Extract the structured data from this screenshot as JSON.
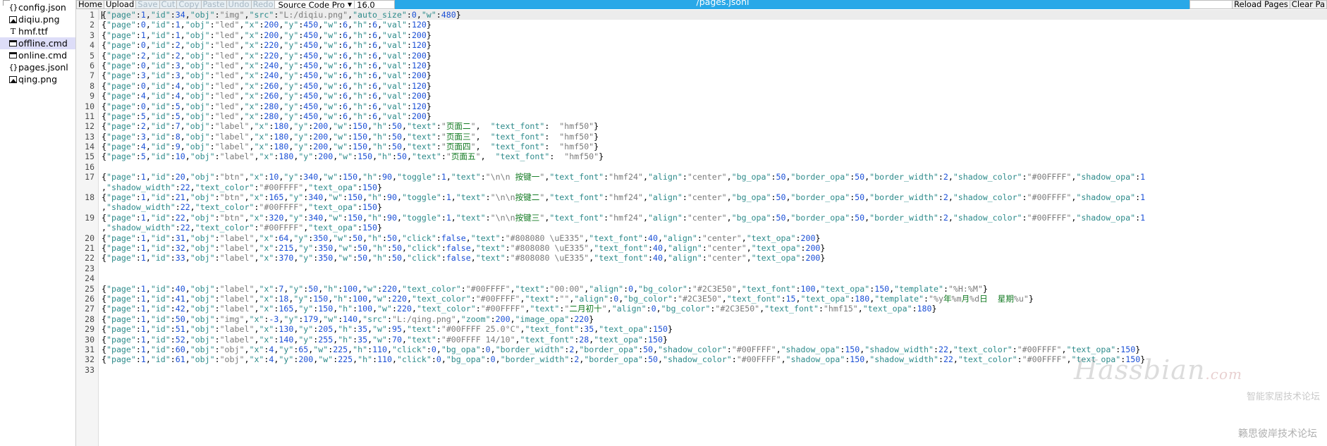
{
  "window": {
    "title": "/pages.jsonl",
    "accent_color": "#29a8e8"
  },
  "sidebar": {
    "files": [
      {
        "name": "config.json",
        "icon": "json-file-icon",
        "glyph": "{}",
        "selected": false
      },
      {
        "name": "diqiu.png",
        "icon": "image-file-icon",
        "glyph": "",
        "selected": false
      },
      {
        "name": "hmf.ttf",
        "icon": "font-file-icon",
        "glyph": "T",
        "selected": false
      },
      {
        "name": "offline.cmd",
        "icon": "cmd-file-icon",
        "glyph": "",
        "selected": true
      },
      {
        "name": "online.cmd",
        "icon": "cmd-file-icon",
        "glyph": "",
        "selected": false
      },
      {
        "name": "pages.jsonl",
        "icon": "json-file-icon",
        "glyph": "{}",
        "selected": false
      },
      {
        "name": "qing.png",
        "icon": "image-file-icon",
        "glyph": "",
        "selected": false
      }
    ]
  },
  "toolbar": {
    "buttons": [
      {
        "label": "Home",
        "state": "normal"
      },
      {
        "label": "Upload",
        "state": "active"
      },
      {
        "label": "Save",
        "state": "disabled"
      },
      {
        "label": "Cut",
        "state": "disabled"
      },
      {
        "label": "Copy",
        "state": "disabled"
      },
      {
        "label": "Paste",
        "state": "disabled"
      },
      {
        "label": "Undo",
        "state": "disabled"
      },
      {
        "label": "Redo",
        "state": "disabled"
      }
    ],
    "font_select": {
      "value": "Source Code Pro",
      "chevron": "chevron-down-icon"
    },
    "font_size": "16.0"
  },
  "toolbar_right": {
    "input_value": "",
    "input_placeholder": "",
    "reload_label": "Reload Pages",
    "clear_label": "Clear Pa"
  },
  "editor": {
    "line_numbers": [
      "1",
      "2",
      "3",
      "4",
      "5",
      "6",
      "7",
      "8",
      "9",
      "10",
      "11",
      "12",
      "13",
      "14",
      "15",
      "16",
      "17",
      "",
      "18",
      "",
      "19",
      "",
      "20",
      "21",
      "22",
      "23",
      "24",
      "25",
      "26",
      "27",
      "28",
      "29",
      "30",
      "31",
      "32",
      "33"
    ],
    "lines": [
      {
        "n": 1,
        "highlight": true,
        "caret": true,
        "text": "{\"page\":1,\"id\":34,\"obj\":\"img\",\"src\":\"L:/diqiu.png\",\"auto_size\":0,\"w\":480}"
      },
      {
        "n": 2,
        "text": "{\"page\":0,\"id\":1,\"obj\":\"led\",\"x\":200,\"y\":450,\"w\":6,\"h\":6,\"val\":120}"
      },
      {
        "n": 3,
        "text": "{\"page\":1,\"id\":1,\"obj\":\"led\",\"x\":200,\"y\":450,\"w\":6,\"h\":6,\"val\":200}"
      },
      {
        "n": 4,
        "text": "{\"page\":0,\"id\":2,\"obj\":\"led\",\"x\":220,\"y\":450,\"w\":6,\"h\":6,\"val\":120}"
      },
      {
        "n": 5,
        "text": "{\"page\":2,\"id\":2,\"obj\":\"led\",\"x\":220,\"y\":450,\"w\":6,\"h\":6,\"val\":200}"
      },
      {
        "n": 6,
        "text": "{\"page\":0,\"id\":3,\"obj\":\"led\",\"x\":240,\"y\":450,\"w\":6,\"h\":6,\"val\":120}"
      },
      {
        "n": 7,
        "text": "{\"page\":3,\"id\":3,\"obj\":\"led\",\"x\":240,\"y\":450,\"w\":6,\"h\":6,\"val\":200}"
      },
      {
        "n": 8,
        "text": "{\"page\":0,\"id\":4,\"obj\":\"led\",\"x\":260,\"y\":450,\"w\":6,\"h\":6,\"val\":120}"
      },
      {
        "n": 9,
        "text": "{\"page\":4,\"id\":4,\"obj\":\"led\",\"x\":260,\"y\":450,\"w\":6,\"h\":6,\"val\":200}"
      },
      {
        "n": 10,
        "text": "{\"page\":0,\"id\":5,\"obj\":\"led\",\"x\":280,\"y\":450,\"w\":6,\"h\":6,\"val\":120}"
      },
      {
        "n": 11,
        "text": "{\"page\":5,\"id\":5,\"obj\":\"led\",\"x\":280,\"y\":450,\"w\":6,\"h\":6,\"val\":200}"
      },
      {
        "n": 12,
        "text": "{\"page\":2,\"id\":7,\"obj\":\"label\",\"x\":180,\"y\":200,\"w\":150,\"h\":50,\"text\":\"页面二\",  \"text_font\":  \"hmf50\"}"
      },
      {
        "n": 13,
        "text": "{\"page\":3,\"id\":8,\"obj\":\"label\",\"x\":180,\"y\":200,\"w\":150,\"h\":50,\"text\":\"页面三\",  \"text_font\":  \"hmf50\"}"
      },
      {
        "n": 14,
        "text": "{\"page\":4,\"id\":9,\"obj\":\"label\",\"x\":180,\"y\":200,\"w\":150,\"h\":50,\"text\":\"页面四\",  \"text_font\":  \"hmf50\"}"
      },
      {
        "n": 15,
        "text": "{\"page\":5,\"id\":10,\"obj\":\"label\",\"x\":180,\"y\":200,\"w\":150,\"h\":50,\"text\":\"页面五\",  \"text_font\":  \"hmf50\"}"
      },
      {
        "n": 16,
        "text": ""
      },
      {
        "n": 17,
        "text": "{\"page\":1,\"id\":20,\"obj\":\"btn\",\"x\":10,\"y\":340,\"w\":150,\"h\":90,\"toggle\":1,\"text\":\"\\n\\n 按键一\",\"text_font\":\"hmf24\",\"align\":\"center\",\"bg_opa\":50,\"border_opa\":50,\"border_width\":2,\"shadow_color\":\"#00FFFF\",\"shadow_opa\":1"
      },
      {
        "n": 17,
        "wrap": true,
        "text": ",\"shadow_width\":22,\"text_color\":\"#00FFFF\",\"text_opa\":150}"
      },
      {
        "n": 18,
        "text": "{\"page\":1,\"id\":21,\"obj\":\"btn\",\"x\":165,\"y\":340,\"w\":150,\"h\":90,\"toggle\":1,\"text\":\"\\n\\n按键二\",\"text_font\":\"hmf24\",\"align\":\"center\",\"bg_opa\":50,\"border_opa\":50,\"border_width\":2,\"shadow_color\":\"#00FFFF\",\"shadow_opa\":1"
      },
      {
        "n": 18,
        "wrap": true,
        "text": ",\"shadow_width\":22,\"text_color\":\"#00FFFF\",\"text_opa\":150}"
      },
      {
        "n": 19,
        "text": "{\"page\":1,\"id\":22,\"obj\":\"btn\",\"x\":320,\"y\":340,\"w\":150,\"h\":90,\"toggle\":1,\"text\":\"\\n\\n按键三\",\"text_font\":\"hmf24\",\"align\":\"center\",\"bg_opa\":50,\"border_opa\":50,\"border_width\":2,\"shadow_color\":\"#00FFFF\",\"shadow_opa\":1"
      },
      {
        "n": 19,
        "wrap": true,
        "text": ",\"shadow_width\":22,\"text_color\":\"#00FFFF\",\"text_opa\":150}"
      },
      {
        "n": 20,
        "text": "{\"page\":1,\"id\":31,\"obj\":\"label\",\"x\":64,\"y\":350,\"w\":50,\"h\":50,\"click\":false,\"text\":\"#808080 \\uE335\",\"text_font\":40,\"align\":\"center\",\"text_opa\":200}"
      },
      {
        "n": 21,
        "text": "{\"page\":1,\"id\":32,\"obj\":\"label\",\"x\":215,\"y\":350,\"w\":50,\"h\":50,\"click\":false,\"text\":\"#808080 \\uE335\",\"text_font\":40,\"align\":\"center\",\"text_opa\":200}"
      },
      {
        "n": 22,
        "text": "{\"page\":1,\"id\":33,\"obj\":\"label\",\"x\":370,\"y\":350,\"w\":50,\"h\":50,\"click\":false,\"text\":\"#808080 \\uE335\",\"text_font\":40,\"align\":\"center\",\"text_opa\":200}"
      },
      {
        "n": 23,
        "text": ""
      },
      {
        "n": 24,
        "text": ""
      },
      {
        "n": 25,
        "text": "{\"page\":1,\"id\":40,\"obj\":\"label\",\"x\":7,\"y\":50,\"h\":100,\"w\":220,\"text_color\":\"#00FFFF\",\"text\":\"00:00\",\"align\":0,\"bg_color\":\"#2C3E50\",\"text_font\":100,\"text_opa\":150,\"template\":\"%H:%M\"}"
      },
      {
        "n": 26,
        "text": "{\"page\":1,\"id\":41,\"obj\":\"label\",\"x\":18,\"y\":150,\"h\":100,\"w\":220,\"text_color\":\"#00FFFF\",\"text\":\"\",\"align\":0,\"bg_color\":\"#2C3E50\",\"text_font\":15,\"text_opa\":180,\"template\":\"%y年%m月%d日  星期%u\"}"
      },
      {
        "n": 27,
        "text": "{\"page\":1,\"id\":42,\"obj\":\"label\",\"x\":165,\"y\":150,\"h\":100,\"w\":220,\"text_color\":\"#00FFFF\",\"text\":\"二月初十\",\"align\":0,\"bg_color\":\"#2C3E50\",\"text_font\":\"hmf15\",\"text_opa\":180}"
      },
      {
        "n": 28,
        "text": "{\"page\":1,\"id\":50,\"obj\":\"img\",\"x\":-3,\"y\":179,\"w\":140,\"src\":\"L:/qing.png\",\"zoom\":200,\"image_opa\":220}"
      },
      {
        "n": 29,
        "text": "{\"page\":1,\"id\":51,\"obj\":\"label\",\"x\":130,\"y\":205,\"h\":35,\"w\":95,\"text\":\"#00FFFF 25.0°C\",\"text_font\":35,\"text_opa\":150}"
      },
      {
        "n": 30,
        "text": "{\"page\":1,\"id\":52,\"obj\":\"label\",\"x\":140,\"y\":255,\"h\":35,\"w\":70,\"text\":\"#00FFFF 14/10\",\"text_font\":28,\"text_opa\":150}"
      },
      {
        "n": 31,
        "text": "{\"page\":1,\"id\":60,\"obj\":\"obj\",\"x\":4,\"y\":65,\"w\":225,\"h\":110,\"click\":0,\"bg_opa\":0,\"border_width\":2,\"border_opa\":50,\"shadow_color\":\"#00FFFF\",\"shadow_opa\":150,\"shadow_width\":22,\"text_color\":\"#00FFFF\",\"text_opa\":150}"
      },
      {
        "n": 32,
        "text": "{\"page\":1,\"id\":61,\"obj\":\"obj\",\"x\":4,\"y\":200,\"w\":225,\"h\":110,\"click\":0,\"bg_opa\":0,\"border_width\":2,\"border_opa\":50,\"shadow_color\":\"#00FFFF\",\"shadow_opa\":150,\"shadow_width\":22,\"text_color\":\"#00FFFF\",\"text_opa\":150}"
      },
      {
        "n": 33,
        "text": ""
      }
    ]
  },
  "watermarks": {
    "brand": "Hassbian",
    "brand_dot": ".com",
    "forum_cn": "智能家居技术论坛",
    "tagline": "籁思彼岸技术论坛"
  }
}
